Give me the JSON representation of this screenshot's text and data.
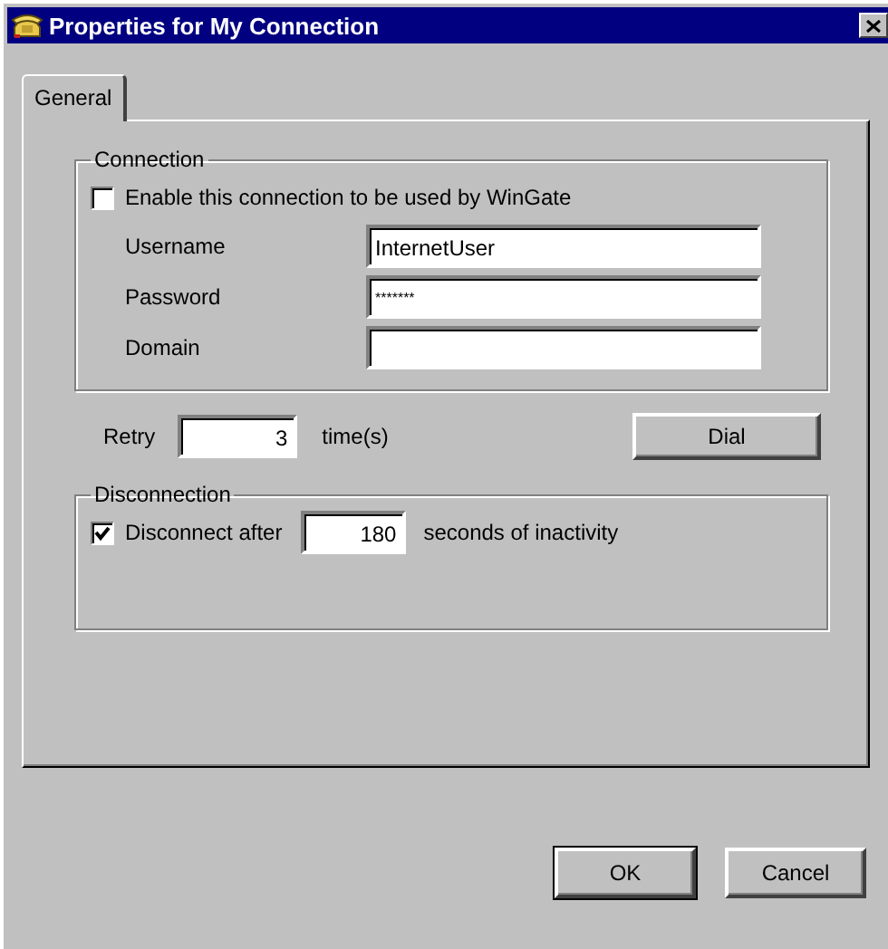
{
  "window": {
    "title": "Properties for My Connection"
  },
  "tabs": [
    {
      "label": "General",
      "selected": true
    }
  ],
  "connection_group": {
    "title": "Connection",
    "enable_checkbox": {
      "label": "Enable this connection to be used by WinGate",
      "checked": false
    },
    "fields": [
      {
        "label": "Username",
        "value": "InternetUser",
        "kind": "text"
      },
      {
        "label": "Password",
        "value": "*******",
        "kind": "password"
      },
      {
        "label": "Domain",
        "kind": "text"
      }
    ]
  },
  "retry": {
    "label": "Retry",
    "value": "3",
    "unit": "time(s)"
  },
  "dial_button": {
    "label": "Dial"
  },
  "disconnection_group": {
    "title": "Disconnection",
    "checkbox": {
      "label": "Disconnect after",
      "checked": true
    },
    "value": "180",
    "suffix": "seconds of inactivity"
  },
  "buttons": [
    {
      "label": "OK",
      "default": true
    },
    {
      "label": "Cancel",
      "default": false
    }
  ]
}
